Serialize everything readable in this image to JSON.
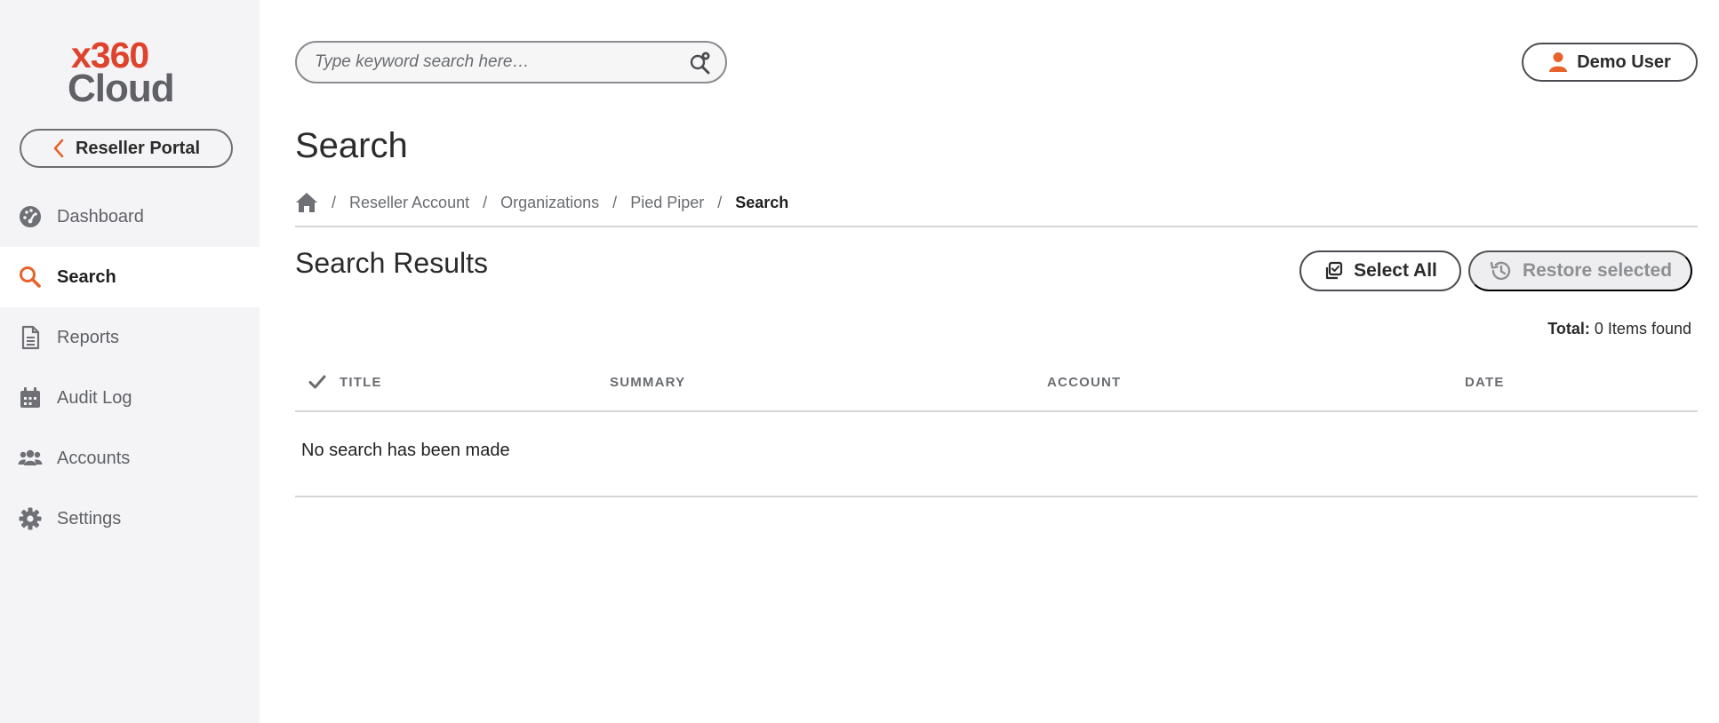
{
  "brand": {
    "logo_top": "x360",
    "logo_bottom": "Cloud",
    "accent": "#e0432c",
    "gray": "#5f6166"
  },
  "sidebar": {
    "portal_button": "Reseller Portal",
    "items": [
      {
        "label": "Dashboard",
        "icon": "dashboard-gauge-icon"
      },
      {
        "label": "Search",
        "icon": "search-icon",
        "active": true
      },
      {
        "label": "Reports",
        "icon": "document-icon"
      },
      {
        "label": "Audit Log",
        "icon": "calendar-icon"
      },
      {
        "label": "Accounts",
        "icon": "users-icon"
      },
      {
        "label": "Settings",
        "icon": "gear-icon"
      }
    ]
  },
  "search": {
    "placeholder": "Type keyword search here…"
  },
  "user": {
    "name": "Demo User"
  },
  "page": {
    "title": "Search"
  },
  "breadcrumb": {
    "items": [
      "Reseller Account",
      "Organizations",
      "Pied Piper"
    ],
    "current": "Search",
    "separator": "/"
  },
  "results": {
    "title": "Search Results",
    "select_all": "Select All",
    "restore": "Restore selected",
    "total_label": "Total:",
    "total_value": "0 Items found"
  },
  "table": {
    "columns": [
      "TITLE",
      "SUMMARY",
      "ACCOUNT",
      "DATE"
    ],
    "empty_message": "No search has been made"
  }
}
